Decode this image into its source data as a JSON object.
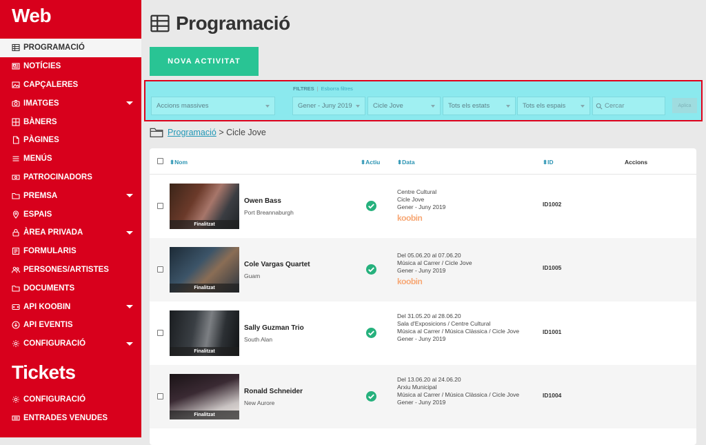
{
  "sidebar": {
    "brand_web": "Web",
    "brand_tickets": "Tickets",
    "items": [
      {
        "label": "PROGRAMACIÓ",
        "icon": "table-icon",
        "active": true
      },
      {
        "label": "NOTÍCIES",
        "icon": "newspaper-icon"
      },
      {
        "label": "CAPÇALERES",
        "icon": "image-icon"
      },
      {
        "label": "IMATGES",
        "icon": "camera-icon",
        "submenu": true
      },
      {
        "label": "BÀNERS",
        "icon": "grid-icon"
      },
      {
        "label": "PÀGINES",
        "icon": "page-icon"
      },
      {
        "label": "MENÚS",
        "icon": "menu-icon"
      },
      {
        "label": "PATROCINADORS",
        "icon": "money-icon"
      },
      {
        "label": "PREMSA",
        "icon": "folder-icon",
        "submenu": true
      },
      {
        "label": "ESPAIS",
        "icon": "pin-icon"
      },
      {
        "label": "ÀREA PRIVADA",
        "icon": "lock-icon",
        "submenu": true
      },
      {
        "label": "FORMULARIS",
        "icon": "form-icon"
      },
      {
        "label": "PERSONES/ARTISTES",
        "icon": "users-icon"
      },
      {
        "label": "DOCUMENTS",
        "icon": "folder-icon"
      },
      {
        "label": "API KOOBIN",
        "icon": "api-icon",
        "submenu": true
      },
      {
        "label": "API EVENTIS",
        "icon": "download-icon"
      },
      {
        "label": "CONFIGURACIÓ",
        "icon": "gear-icon",
        "submenu": true
      }
    ],
    "ticket_items": [
      {
        "label": "CONFIGURACIÓ",
        "icon": "gear-icon"
      },
      {
        "label": "ENTRADES VENUDES",
        "icon": "ticket-icon"
      }
    ]
  },
  "page": {
    "title": "Programació",
    "new_button": "NOVA ACTIVITAT"
  },
  "filters": {
    "label": "FILTRES",
    "separator": "|",
    "clear": "Esborra filtres",
    "mass_actions": "Accions massives",
    "period": "Gener - Juny 2019",
    "cycle": "Cicle Jove",
    "status": "Tots els estats",
    "spaces": "Tots els espais",
    "search_placeholder": "Cercar",
    "apply": "Aplica"
  },
  "breadcrumb": {
    "link": "Programació",
    "current": "> Cicle Jove"
  },
  "table": {
    "headers": {
      "name": "Nom",
      "active": "Actiu",
      "date": "Data",
      "id": "ID",
      "actions": "Accions"
    },
    "rows": [
      {
        "name": "Owen Bass",
        "location": "Port Breannaburgh",
        "status_caption": "Finalitzat",
        "data": [
          "Centre Cultural",
          "Cicle Jove",
          "Gener - Juny 2019"
        ],
        "koobin": "koobin",
        "id": "ID1002"
      },
      {
        "name": "Cole Vargas Quartet",
        "location": "Guam",
        "status_caption": "Finalitzat",
        "data": [
          "Del 05.06.20 al 07.06.20",
          "Música al Carrer / Cicle Jove",
          "Gener - Juny 2019"
        ],
        "koobin": "koobin",
        "id": "ID1005"
      },
      {
        "name": "Sally Guzman Trio",
        "location": "South Alan",
        "status_caption": "Finalitzat",
        "data": [
          "Del 31.05.20 al 28.06.20",
          "Sala d'Exposicions / Centre Cultural",
          "Música al Carrer / Música Clàssica / Cicle Jove",
          "Gener - Juny 2019"
        ],
        "id": "ID1001"
      },
      {
        "name": "Ronald Schneider",
        "location": "New Aurore",
        "status_caption": "Finalitzat",
        "data": [
          "Del 13.06.20 al 24.06.20",
          "Arxiu Municipal",
          "Música al Carrer / Música Clàssica / Cicle Jove",
          "Gener - Juny 2019"
        ],
        "id": "ID1004"
      }
    ]
  }
}
